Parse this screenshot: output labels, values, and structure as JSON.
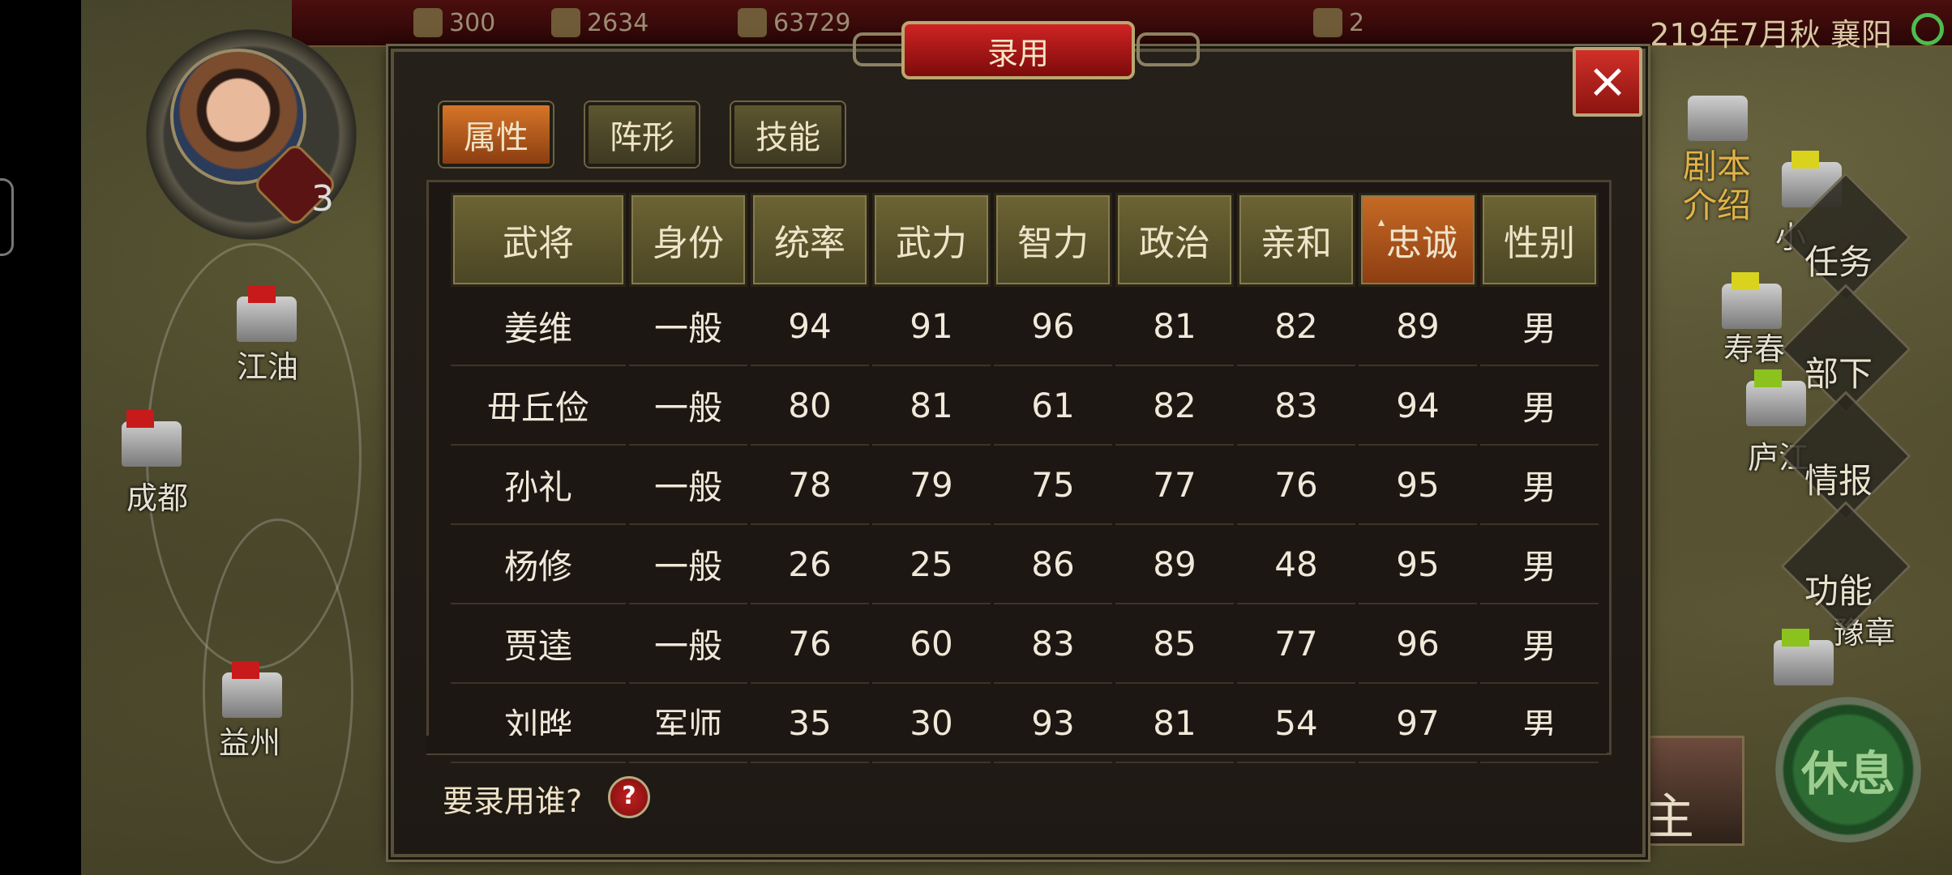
{
  "topbar": {
    "resources": [
      {
        "value": "300",
        "icon": "grain-icon"
      },
      {
        "value": "2634",
        "icon": "gold-icon"
      },
      {
        "value": "63729",
        "icon": "troops-icon"
      },
      {
        "value": "2",
        "icon": "scroll-icon"
      }
    ],
    "date_location": "219年7月秋 襄阳"
  },
  "avatar": {
    "badge_count": "3"
  },
  "map": {
    "cities": [
      "江油",
      "成都",
      "益州",
      "寿春",
      "庐江",
      "豫章",
      "小"
    ]
  },
  "side_menu": {
    "intro_label": "剧本\n介绍",
    "items": [
      "任务",
      "部下",
      "情报",
      "功能"
    ],
    "rest_button": "休息",
    "thumb_text": "主"
  },
  "dialog": {
    "title": "录用",
    "close_label": "×",
    "tabs": [
      "属性",
      "阵形",
      "技能"
    ],
    "active_tab": "属性",
    "columns": [
      "武将",
      "身份",
      "统率",
      "武力",
      "智力",
      "政治",
      "亲和",
      "忠诚",
      "性别"
    ],
    "sorted_column": "忠诚",
    "sort_caret": "▴",
    "rows": [
      [
        "姜维",
        "一般",
        "94",
        "91",
        "96",
        "81",
        "82",
        "89",
        "男"
      ],
      [
        "毌丘俭",
        "一般",
        "80",
        "81",
        "61",
        "82",
        "83",
        "94",
        "男"
      ],
      [
        "孙礼",
        "一般",
        "78",
        "79",
        "75",
        "77",
        "76",
        "95",
        "男"
      ],
      [
        "杨修",
        "一般",
        "26",
        "25",
        "86",
        "89",
        "48",
        "95",
        "男"
      ],
      [
        "贾逵",
        "一般",
        "76",
        "60",
        "83",
        "85",
        "77",
        "96",
        "男"
      ],
      [
        "刘晔",
        "军师",
        "35",
        "30",
        "93",
        "81",
        "54",
        "97",
        "男"
      ]
    ],
    "prompt": "要录用谁?",
    "help_label": "?"
  },
  "colors": {
    "accent_orange": "#d67528",
    "title_red": "#cf2323",
    "header_olive": "#6d6434"
  }
}
